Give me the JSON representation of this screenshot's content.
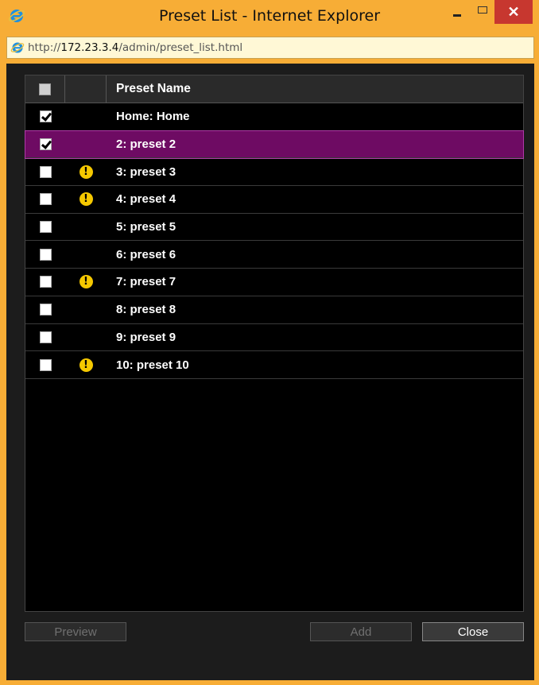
{
  "window": {
    "title": "Preset List - Internet Explorer",
    "close_glyph": "✕"
  },
  "address": {
    "scheme": "http://",
    "host": "172.23.3.4",
    "path": "/admin/preset_list.html"
  },
  "grid": {
    "header": {
      "name_label": "Preset Name"
    },
    "rows": [
      {
        "checked": true,
        "warning": false,
        "name": "Home: Home",
        "selected": false
      },
      {
        "checked": true,
        "warning": false,
        "name": "2: preset 2",
        "selected": true
      },
      {
        "checked": false,
        "warning": true,
        "name": "3: preset 3",
        "selected": false
      },
      {
        "checked": false,
        "warning": true,
        "name": "4: preset 4",
        "selected": false
      },
      {
        "checked": false,
        "warning": false,
        "name": "5: preset 5",
        "selected": false
      },
      {
        "checked": false,
        "warning": false,
        "name": "6: preset 6",
        "selected": false
      },
      {
        "checked": false,
        "warning": true,
        "name": "7: preset 7",
        "selected": false
      },
      {
        "checked": false,
        "warning": false,
        "name": "8: preset 8",
        "selected": false
      },
      {
        "checked": false,
        "warning": false,
        "name": "9: preset 9",
        "selected": false
      },
      {
        "checked": false,
        "warning": true,
        "name": "10: preset 10",
        "selected": false
      }
    ]
  },
  "buttons": {
    "preview": "Preview",
    "add": "Add",
    "close": "Close"
  },
  "colors": {
    "titlebar": "#f7ad36",
    "selected_row": "#6e0b63",
    "warning": "#f5c800"
  },
  "icons": {
    "warning_glyph": "!"
  }
}
